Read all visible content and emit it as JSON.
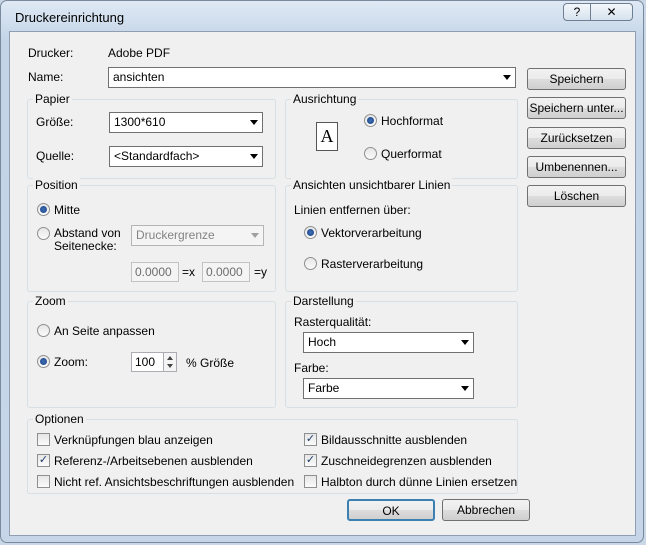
{
  "window": {
    "title": "Druckereinrichtung",
    "help_glyph": "?",
    "close_glyph": "✕"
  },
  "printer": {
    "label": "Drucker:",
    "value": "Adobe PDF"
  },
  "name": {
    "label": "Name:",
    "value": "ansichten"
  },
  "paper": {
    "title": "Papier",
    "size_label": "Größe:",
    "size_value": "1300*610",
    "source_label": "Quelle:",
    "source_value": "<Standardfach>"
  },
  "orientation": {
    "title": "Ausrichtung",
    "icon_glyph": "A",
    "portrait": "Hochformat",
    "landscape": "Querformat",
    "selected": "portrait"
  },
  "position": {
    "title": "Position",
    "center": "Mitte",
    "offset_line1": "Abstand von",
    "offset_line2": "Seitenecke:",
    "offset_combo": "Druckergrenze",
    "x_value": "0.0000 r",
    "x_suffix": "=x",
    "y_value": "0.0000 r",
    "y_suffix": "=y",
    "selected": "center"
  },
  "hidden_lines": {
    "title": "Ansichten unsichtbarer Linien",
    "remove_label": "Linien entfernen über:",
    "vector": "Vektorverarbeitung",
    "raster": "Rasterverarbeitung",
    "selected": "vector"
  },
  "zoom": {
    "title": "Zoom",
    "fit": "An Seite anpassen",
    "zoom_label": "Zoom:",
    "zoom_value": "100",
    "zoom_suffix": "% Größe",
    "selected": "zoom"
  },
  "display": {
    "title": "Darstellung",
    "raster_label": "Rasterqualität:",
    "raster_value": "Hoch",
    "color_label": "Farbe:",
    "color_value": "Farbe"
  },
  "options": {
    "title": "Optionen",
    "items": [
      {
        "label": "Verknüpfungen blau anzeigen",
        "checked": false
      },
      {
        "label": "Referenz-/Arbeitsebenen ausblenden",
        "checked": true
      },
      {
        "label": "Nicht ref. Ansichtsbeschriftungen ausblenden",
        "checked": false
      },
      {
        "label": "Bildausschnitte ausblenden",
        "checked": true
      },
      {
        "label": "Zuschneidegrenzen ausblenden",
        "checked": true
      },
      {
        "label": "Halbton durch dünne Linien ersetzen",
        "checked": false
      }
    ]
  },
  "side_buttons": {
    "save": "Speichern",
    "save_as": "Speichern unter...",
    "reset": "Zurücksetzen",
    "rename": "Umbenennen...",
    "delete": "Löschen"
  },
  "footer": {
    "ok": "OK",
    "cancel": "Abbrechen"
  },
  "check_glyph": "✓"
}
